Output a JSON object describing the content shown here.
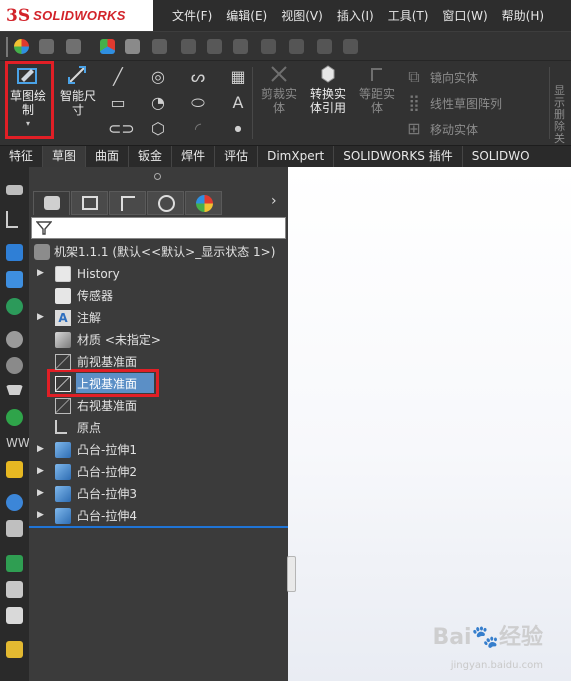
{
  "app": {
    "logo_ds": "3S",
    "logo_text": "SOLIDWORKS",
    "accent": "#d2232a"
  },
  "menubar": {
    "items": [
      "文件(F)",
      "编辑(E)",
      "视图(V)",
      "插入(I)",
      "工具(T)",
      "窗口(W)",
      "帮助(H)"
    ]
  },
  "commands": {
    "sketch": "草图绘制",
    "smart_dim": "智能尺寸",
    "trim": "剪裁实体",
    "convert": "转换实体引用",
    "offset": "等距实体",
    "mirror": "镜向实体",
    "linear_pattern": "线性草图阵列",
    "move": "移动实体",
    "overflow": "显示删除关"
  },
  "tabs": [
    "特征",
    "草图",
    "曲面",
    "钣金",
    "焊件",
    "评估",
    "DimXpert",
    "SOLIDWORKS 插件",
    "SOLIDWO"
  ],
  "tree": {
    "root": "机架1.1.1  (默认<<默认>_显示状态 1>)",
    "items": [
      {
        "label": "History",
        "icon": "history-icon",
        "expandable": true
      },
      {
        "label": "传感器",
        "icon": "sensor-icon",
        "expandable": false
      },
      {
        "label": "注解",
        "icon": "annotation-icon",
        "expandable": true
      },
      {
        "label": "材质 <未指定>",
        "icon": "material-icon",
        "expandable": false
      },
      {
        "label": "前视基准面",
        "icon": "plane-icon",
        "expandable": false
      },
      {
        "label": "上视基准面",
        "icon": "plane-icon",
        "expandable": false,
        "selected": true
      },
      {
        "label": "右视基准面",
        "icon": "plane-icon",
        "expandable": false
      },
      {
        "label": "原点",
        "icon": "origin-icon",
        "expandable": false
      },
      {
        "label": "凸台-拉伸1",
        "icon": "boss-extrude-icon",
        "expandable": true
      },
      {
        "label": "凸台-拉伸2",
        "icon": "boss-extrude-icon",
        "expandable": true
      },
      {
        "label": "凸台-拉伸3",
        "icon": "boss-extrude-icon",
        "expandable": true
      },
      {
        "label": "凸台-拉伸4",
        "icon": "boss-extrude-icon",
        "expandable": true
      }
    ]
  },
  "watermark": {
    "text": "Bai🐾经验",
    "sub": "jingyan.baidu.com"
  },
  "colors": {
    "highlight": "#e11f26",
    "selection": "#5b8fc6",
    "rollback": "#1f74d6"
  }
}
